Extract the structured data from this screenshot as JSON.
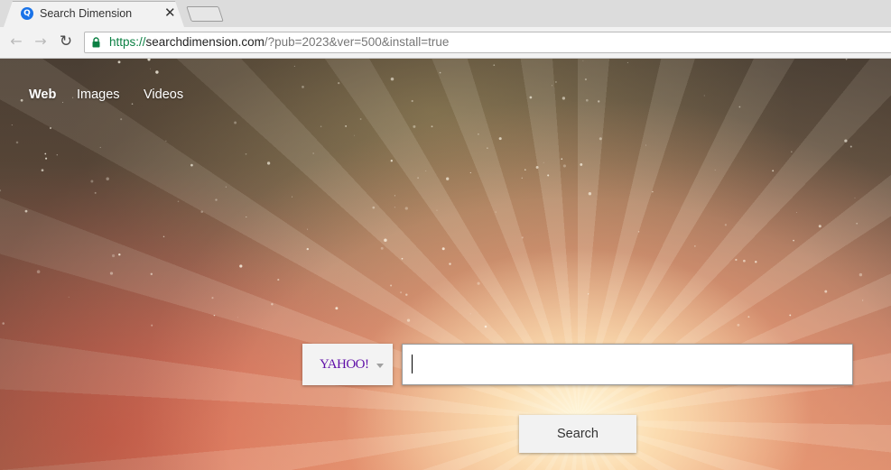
{
  "browser": {
    "tab": {
      "title": "Search Dimension",
      "favicon_glyph": "Q",
      "close_glyph": "✕"
    },
    "nav_glyphs": {
      "back": "←",
      "forward": "→",
      "reload": "↻"
    },
    "url": {
      "scheme": "https://",
      "host": "searchdimension.com",
      "path": "/?pub=2023&ver=500&install=true"
    },
    "colors": {
      "secure": "#0b8043",
      "favicon": "#1a73e8"
    }
  },
  "page": {
    "nav": {
      "web": "Web",
      "images": "Images",
      "videos": "Videos"
    },
    "search": {
      "provider": "YAHOO!",
      "query": "",
      "button_label": "Search"
    },
    "colors": {
      "provider_purple": "#5f0fa8"
    }
  }
}
